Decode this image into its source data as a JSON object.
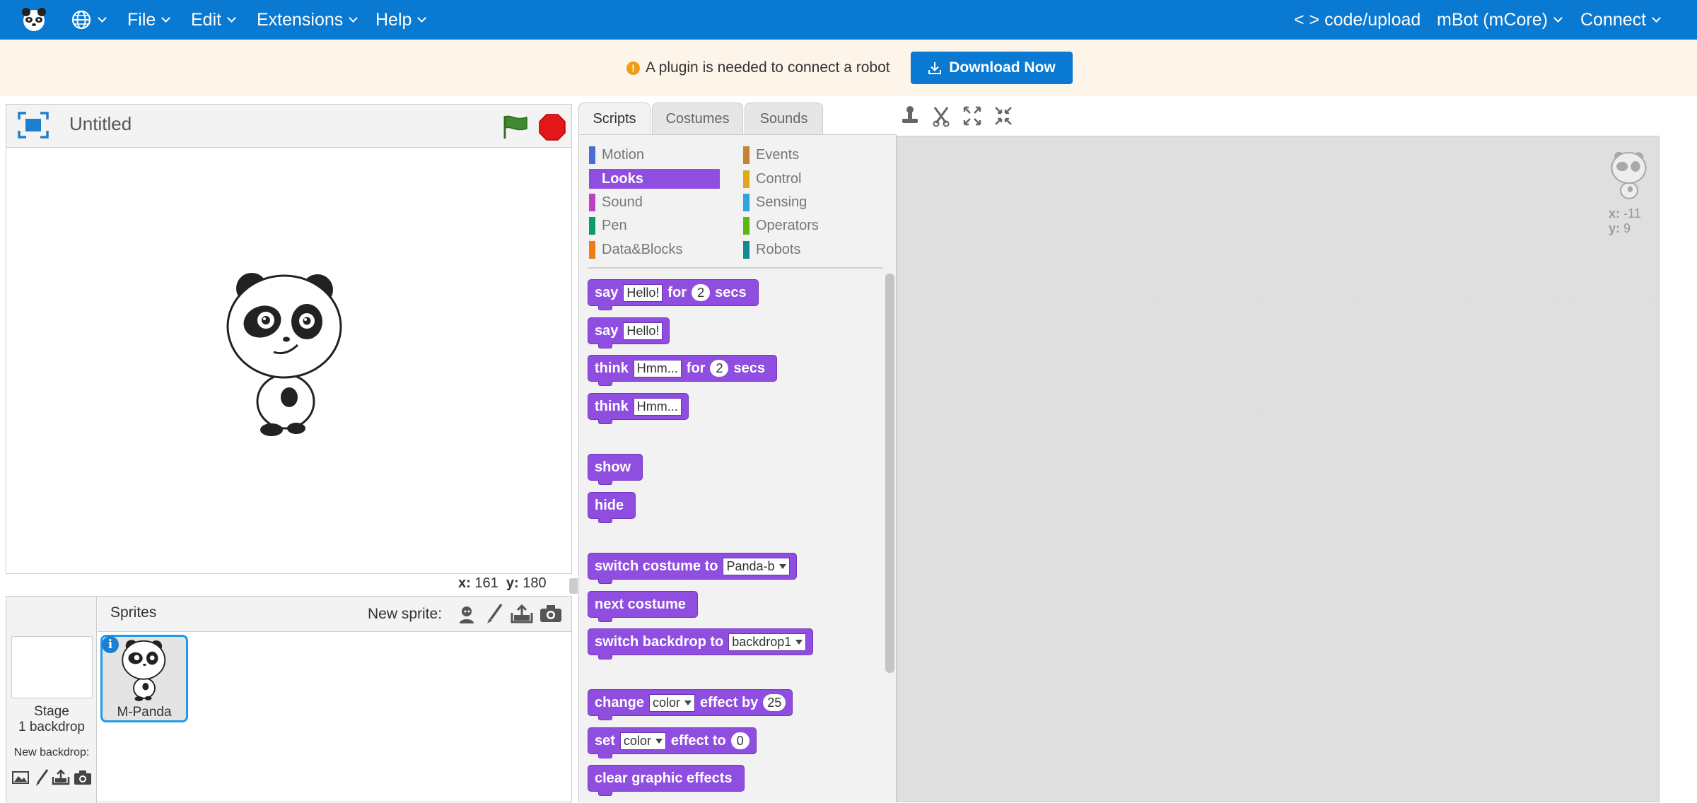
{
  "topbar": {
    "file": "File",
    "edit": "Edit",
    "extensions": "Extensions",
    "help": "Help",
    "code_upload": "< > code/upload",
    "device": "mBot (mCore)",
    "connect": "Connect",
    "colors": {
      "bar": "#0a79d2"
    }
  },
  "banner": {
    "warning_icon_text": "!",
    "message": "A plugin is needed to connect a robot",
    "download_button": "Download Now"
  },
  "stage": {
    "title": "Untitled",
    "coords": {
      "x_label": "x:",
      "x_value": "161",
      "y_label": "y:",
      "y_value": "180"
    }
  },
  "sprites": {
    "header": "Sprites",
    "new_sprite_label": "New sprite:",
    "stage_label": "Stage",
    "backdrop_count": "1 backdrop",
    "new_backdrop_label": "New backdrop:",
    "info_badge": "i",
    "items": [
      {
        "name": "M-Panda",
        "selected": true
      }
    ]
  },
  "tabs": [
    {
      "label": "Scripts",
      "active": true
    },
    {
      "label": "Costumes",
      "active": false
    },
    {
      "label": "Sounds",
      "active": false
    }
  ],
  "categories": [
    {
      "label": "Motion",
      "color": "#4a6cd4",
      "active": false
    },
    {
      "label": "Looks",
      "color": "#8f4ee0",
      "active": true
    },
    {
      "label": "Sound",
      "color": "#bb42c3",
      "active": false
    },
    {
      "label": "Pen",
      "color": "#0e9a6c",
      "active": false
    },
    {
      "label": "Data&Blocks",
      "color": "#ee7d16",
      "active": false
    },
    {
      "label": "Events",
      "color": "#c88330",
      "active": false
    },
    {
      "label": "Control",
      "color": "#e1a91a",
      "active": false
    },
    {
      "label": "Sensing",
      "color": "#2ca5e2",
      "active": false
    },
    {
      "label": "Operators",
      "color": "#5cb712",
      "active": false
    },
    {
      "label": "Robots",
      "color": "#0e8b95",
      "active": false
    }
  ],
  "blocks": {
    "say_for": {
      "w1": "say",
      "text": "Hello!",
      "w2": "for",
      "num": "2",
      "w3": "secs"
    },
    "say": {
      "w1": "say",
      "text": "Hello!"
    },
    "think_for": {
      "w1": "think",
      "text": "Hmm...",
      "w2": "for",
      "num": "2",
      "w3": "secs"
    },
    "think": {
      "w1": "think",
      "text": "Hmm..."
    },
    "show": {
      "w1": "show"
    },
    "hide": {
      "w1": "hide"
    },
    "switch_costume": {
      "w1": "switch costume to",
      "dd": "Panda-b"
    },
    "next_costume": {
      "w1": "next costume"
    },
    "switch_backdrop": {
      "w1": "switch backdrop to",
      "dd": "backdrop1"
    },
    "change_effect": {
      "w1": "change",
      "dd": "color",
      "w2": "effect by",
      "num": "25"
    },
    "set_effect": {
      "w1": "set",
      "dd": "color",
      "w2": "effect to",
      "num": "0"
    },
    "clear_effects": {
      "w1": "clear graphic effects"
    }
  },
  "script_area": {
    "sprite_x_label": "x:",
    "sprite_x": "-11",
    "sprite_y_label": "y:",
    "sprite_y": "9"
  }
}
